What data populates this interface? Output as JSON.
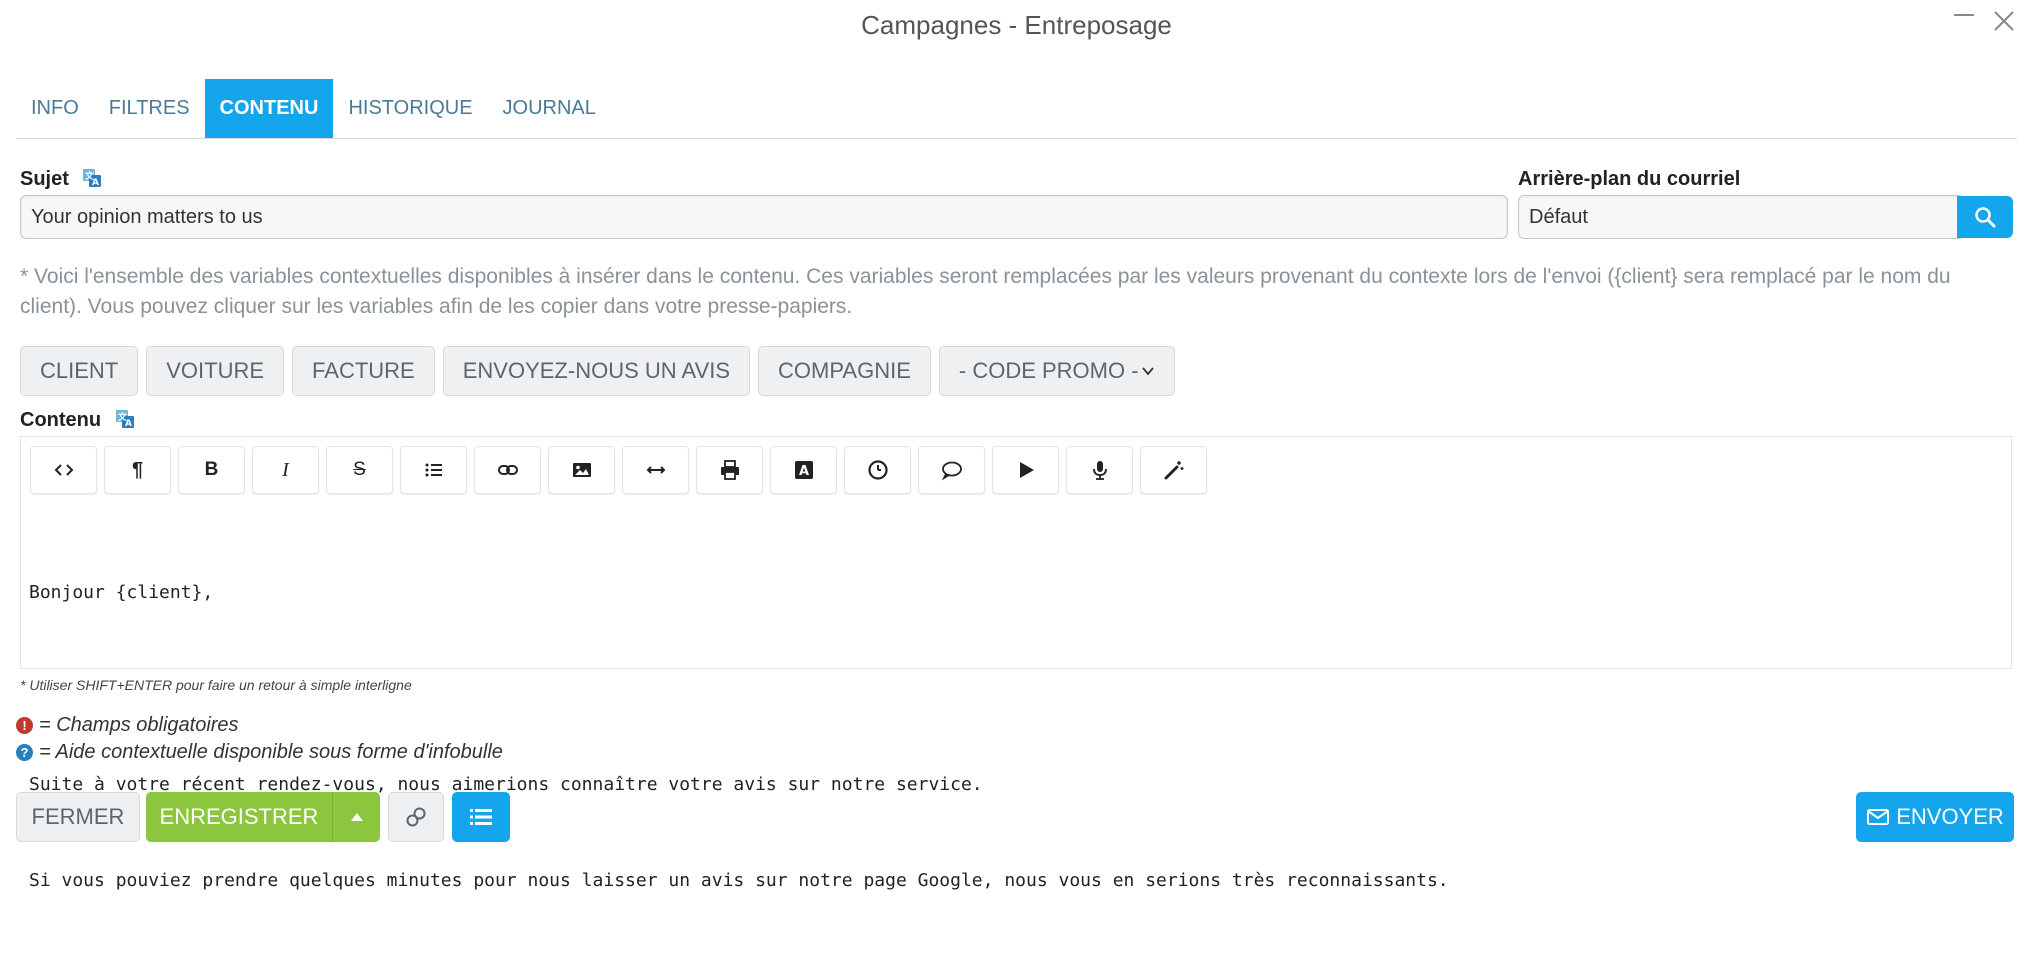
{
  "window": {
    "title": "Campagnes - Entreposage"
  },
  "tabs": [
    {
      "label": "INFO"
    },
    {
      "label": "FILTRES"
    },
    {
      "label": "CONTENU",
      "active": true
    },
    {
      "label": "HISTORIQUE"
    },
    {
      "label": "JOURNAL"
    }
  ],
  "subject": {
    "label": "Sujet",
    "value": "Your opinion matters to us"
  },
  "background": {
    "label": "Arrière-plan du courriel",
    "value": "Défaut"
  },
  "note": "* Voici l'ensemble des variables contextuelles disponibles à insérer dans le contenu. Ces variables seront remplacées par les valeurs provenant du contexte lors de l'envoi ({client} sera remplacé par le nom du client). Vous pouvez cliquer sur les variables afin de les copier dans votre presse-papiers.",
  "variables": [
    {
      "label": "CLIENT"
    },
    {
      "label": "VOITURE"
    },
    {
      "label": "FACTURE"
    },
    {
      "label": "ENVOYEZ-NOUS UN AVIS"
    },
    {
      "label": "COMPAGNIE"
    }
  ],
  "promo_select": {
    "value": "- CODE PROMO -"
  },
  "content": {
    "label": "Contenu",
    "lines": [
      "Bonjour {client},",
      "",
      "Suite à votre récent rendez-vous, nous aimerions connaître votre avis sur notre service.",
      "Si vous pouviez prendre quelques minutes pour nous laisser un avis sur notre page Google, nous vous en serions très reconnaissants."
    ],
    "toolbar": [
      "code-view-icon",
      "paragraph-icon",
      "bold-icon",
      "italic-icon",
      "strikethrough-icon",
      "list-icon",
      "link-icon",
      "image-icon",
      "horizontal-rule-icon",
      "print-icon",
      "font-style-icon",
      "clock-icon",
      "comment-icon",
      "play-icon",
      "microphone-icon",
      "magic-wand-icon"
    ]
  },
  "hint": "* Utiliser SHIFT+ENTER pour faire un retour à simple interligne",
  "legend": {
    "required": "= Champs obligatoires",
    "help": "= Aide contextuelle disponible sous forme d'infobulle"
  },
  "buttons": {
    "close": "FERMER",
    "save": "ENREGISTRER",
    "send": "ENVOYER"
  },
  "colors": {
    "accent": "#14a5ed",
    "save": "#8cc63f",
    "required": "#c0392b",
    "help": "#2980b9"
  }
}
